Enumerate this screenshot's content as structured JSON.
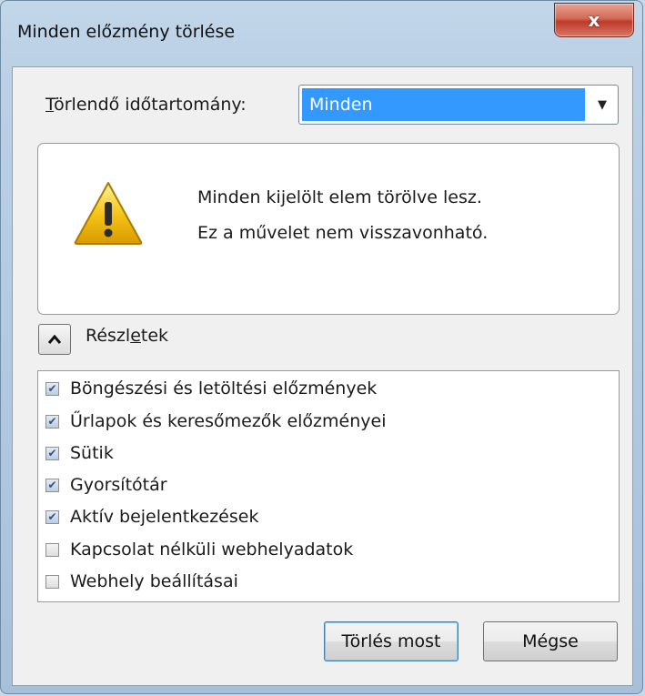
{
  "window": {
    "title": "Minden előzmény törlése",
    "close_label": "x"
  },
  "range": {
    "label_prefix": "T",
    "label_rest": "örlendő időtartomány:",
    "value": "Minden"
  },
  "warning": {
    "line1": "Minden kijelölt elem törölve lesz.",
    "line2": "Ez a művelet nem visszavonható."
  },
  "details": {
    "label_before": "Részl",
    "label_accel": "e",
    "label_after": "tek",
    "items": [
      {
        "label": "Böngészési és letöltési előzmények",
        "checked": true
      },
      {
        "label": "Űrlapok és keresőmezők előzményei",
        "checked": true
      },
      {
        "label": "Sütik",
        "checked": true
      },
      {
        "label": "Gyorsítótár",
        "checked": true
      },
      {
        "label": "Aktív bejelentkezések",
        "checked": true
      },
      {
        "label": "Kapcsolat nélküli webhelyadatok",
        "checked": false
      },
      {
        "label": "Webhely beállításai",
        "checked": false
      }
    ]
  },
  "buttons": {
    "clear_now": "Törlés most",
    "cancel": "Mégse"
  },
  "colors": {
    "selection": "#3399ff",
    "warning_yellow": "#f5c518"
  }
}
